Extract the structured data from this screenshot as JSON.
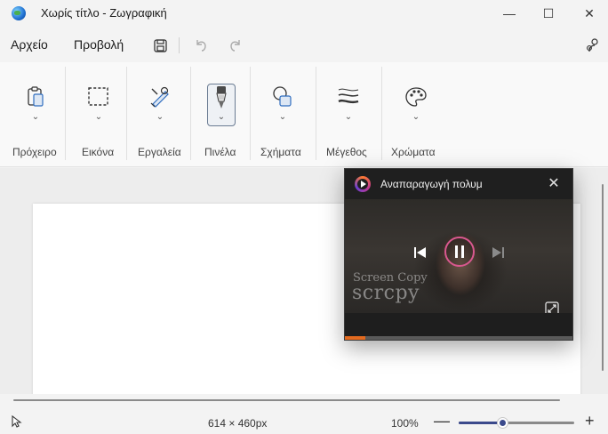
{
  "window": {
    "title": "Χωρίς τίτλο - Ζωγραφική",
    "controls": {
      "minimize": "—",
      "maximize": "☐",
      "close": "✕"
    }
  },
  "menu": {
    "file": "Αρχείο",
    "view": "Προβολή"
  },
  "ribbon": {
    "groups": [
      {
        "label": "Πρόχειρο",
        "icon": "clipboard-icon"
      },
      {
        "label": "Εικόνα",
        "icon": "selection-icon"
      },
      {
        "label": "Εργαλεία",
        "icon": "tools-icon"
      },
      {
        "label": "Πινέλα",
        "icon": "brush-icon",
        "selected": true
      },
      {
        "label": "Σχήματα",
        "icon": "shapes-icon"
      },
      {
        "label": "Μέγεθος",
        "icon": "size-icon"
      },
      {
        "label": "Χρώματα",
        "icon": "palette-icon"
      }
    ],
    "chevron": "⌄"
  },
  "statusbar": {
    "dimensions": "614 × 460px",
    "zoom": "100%",
    "zoom_minus": "—",
    "zoom_plus": "+",
    "zoom_level_fraction": 0.38
  },
  "player": {
    "title": "Αναπαραγωγή πολυμ",
    "close": "✕",
    "watermark_line1": "Screen Copy",
    "watermark_line2": "scrcpy",
    "progress_fraction": 0.09,
    "accent": "#e36a1f",
    "ring": "#d9588f"
  },
  "colors": {
    "accent": "#3b4a8c",
    "window_bg": "#f3f3f3",
    "canvas": "#ffffff"
  }
}
